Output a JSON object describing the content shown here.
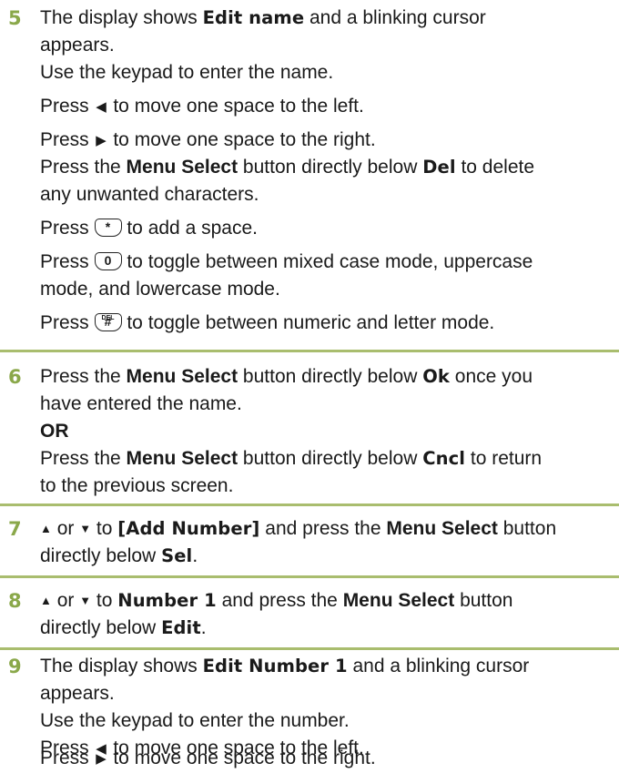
{
  "steps": [
    {
      "number": "5",
      "l1_pre": "The display shows ",
      "l1_disp": "Edit name",
      "l1_post": " and a blinking cursor",
      "l2": "appears.",
      "l3": "Use the keypad to enter the name.",
      "l4_pre": "Press ",
      "l4_post": " to move one space to the left.",
      "l5_pre": "Press ",
      "l5_post": " to move one space to the right.",
      "l6_pre": "Press the ",
      "l6_bold": "Menu Select",
      "l6_mid": " button directly below ",
      "l6_disp": "Del",
      "l6_post": " to delete",
      "l7": "any unwanted characters.",
      "l8_pre": "Press ",
      "l8_post": " to add a space.",
      "l9_pre": "Press ",
      "l9_post": " to toggle between mixed case mode, uppercase",
      "l10": "mode, and lowercase mode.",
      "l11_pre": "Press ",
      "l11_post": " to toggle between numeric and letter mode."
    },
    {
      "number": "6",
      "l1_pre": "Press the ",
      "l1_bold": "Menu Select",
      "l1_mid": " button directly below ",
      "l1_disp": "Ok",
      "l1_post": " once you",
      "l2": "have entered the name.",
      "l3": "OR",
      "l4_pre": "Press the ",
      "l4_bold": "Menu Select",
      "l4_mid": " button directly below ",
      "l4_disp": "Cncl",
      "l4_post": " to return",
      "l5": "to the previous screen."
    },
    {
      "number": "7",
      "or": " or ",
      "to": " to ",
      "disp": "[Add Number]",
      "mid": " and press the ",
      "bold": "Menu Select",
      "post": " button",
      "l2_pre": "directly below ",
      "l2_disp": "Sel",
      "l2_post": "."
    },
    {
      "number": "8",
      "or": " or ",
      "to": " to ",
      "disp": "Number 1",
      "mid": " and press the ",
      "bold": "Menu Select",
      "post": " button",
      "l2_pre": "directly below ",
      "l2_disp": "Edit",
      "l2_post": "."
    },
    {
      "number": "9",
      "l1_pre": "The display shows ",
      "l1_disp": "Edit Number 1",
      "l1_post": " and a blinking cursor",
      "l2": "appears.",
      "l3": "Use the keypad to enter the number.",
      "l4_pre": "Press ",
      "l4_post": " to move one space to the left.",
      "l5_pre": "Press ",
      "l5_post": " to move one space to the right."
    }
  ],
  "icons": {
    "left": "left-arrow-icon",
    "right": "right-arrow-icon",
    "up": "up-arrow-icon",
    "down": "down-arrow-icon",
    "star_key": "star-key-icon",
    "zero_key": "zero-key-icon",
    "hash_key": "hash-del-key-icon"
  },
  "keys": {
    "star": "*",
    "zero": "0",
    "hash": "#",
    "hash_sub": "DEL"
  },
  "colors": {
    "step_number": "#8aa84a",
    "rule": "#a9bd6e"
  }
}
